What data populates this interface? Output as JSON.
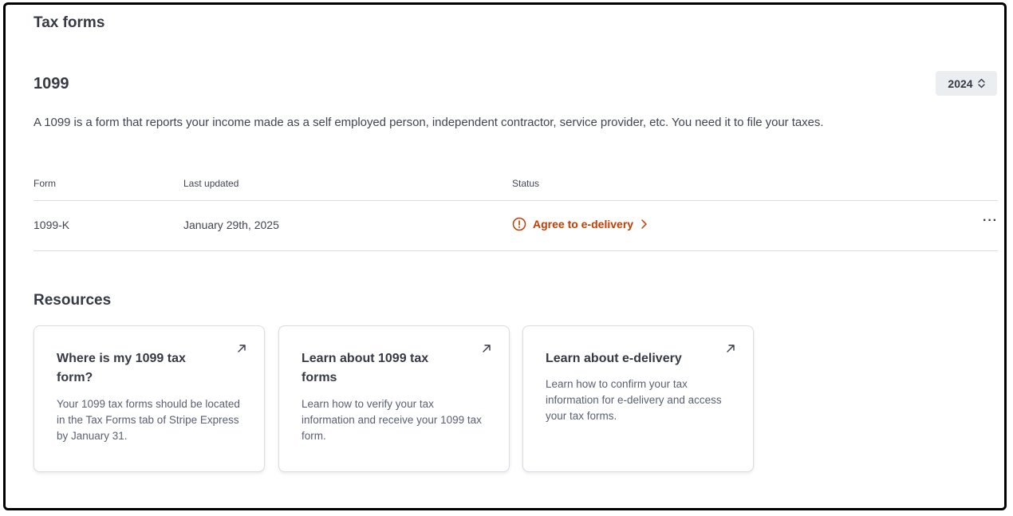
{
  "page": {
    "title": "Tax forms"
  },
  "section": {
    "title": "1099",
    "year_select": {
      "value": "2024"
    },
    "description": "A 1099 is a form that reports your income made as a self employed person, independent contractor, service provider, etc. You need it to file your taxes."
  },
  "table": {
    "columns": [
      "Form",
      "Last updated",
      "Status"
    ],
    "rows": [
      {
        "form": "1099-K",
        "last_updated": "January 29th, 2025",
        "status": "Agree to e-delivery",
        "status_icon": "alert-circle-icon",
        "more_label": "···"
      }
    ]
  },
  "resources": {
    "title": "Resources",
    "cards": [
      {
        "title": "Where is my 1099 tax form?",
        "body": "Your 1099 tax forms should be located in the Tax Forms tab of Stripe Express by January 31.",
        "icon": "external-arrow-icon"
      },
      {
        "title": "Learn about 1099 tax forms",
        "body": "Learn how to verify your tax information and receive your 1099 tax form.",
        "icon": "external-arrow-icon"
      },
      {
        "title": "Learn about e-delivery",
        "body": "Learn how to confirm your tax information for e-delivery and access your tax forms.",
        "icon": "external-arrow-icon"
      }
    ]
  },
  "colors": {
    "status_warning": "#c23d00",
    "text_primary": "#353a44",
    "text_secondary": "#596171",
    "border": "#d8dde3",
    "select_bg": "#ebeef1"
  }
}
